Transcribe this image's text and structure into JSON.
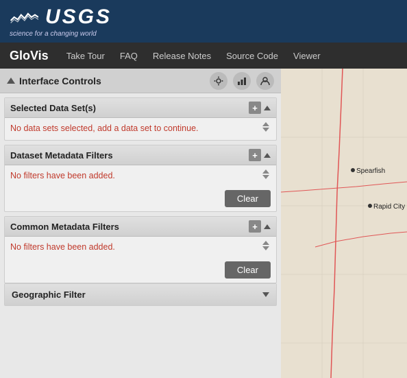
{
  "usgs": {
    "logo_text": "USGS",
    "tagline": "science for a changing world"
  },
  "nav": {
    "brand": "GloVis",
    "links": [
      "Take Tour",
      "FAQ",
      "Release Notes",
      "Source Code",
      "Viewer"
    ]
  },
  "interface_controls": {
    "title": "Interface Controls"
  },
  "selected_datasets": {
    "title": "Selected Data Set(s)",
    "message": "No data sets selected, add a data set to continue."
  },
  "dataset_metadata": {
    "title": "Dataset Metadata Filters",
    "message": "No filters have been added.",
    "clear_label": "Clear"
  },
  "common_metadata": {
    "title": "Common Metadata Filters",
    "message": "No filters have been added.",
    "clear_label": "Clear"
  },
  "geographic_filter": {
    "title": "Geographic Filter"
  },
  "map": {
    "city_label": "Spearfish",
    "city2_label": "Rapid City"
  }
}
